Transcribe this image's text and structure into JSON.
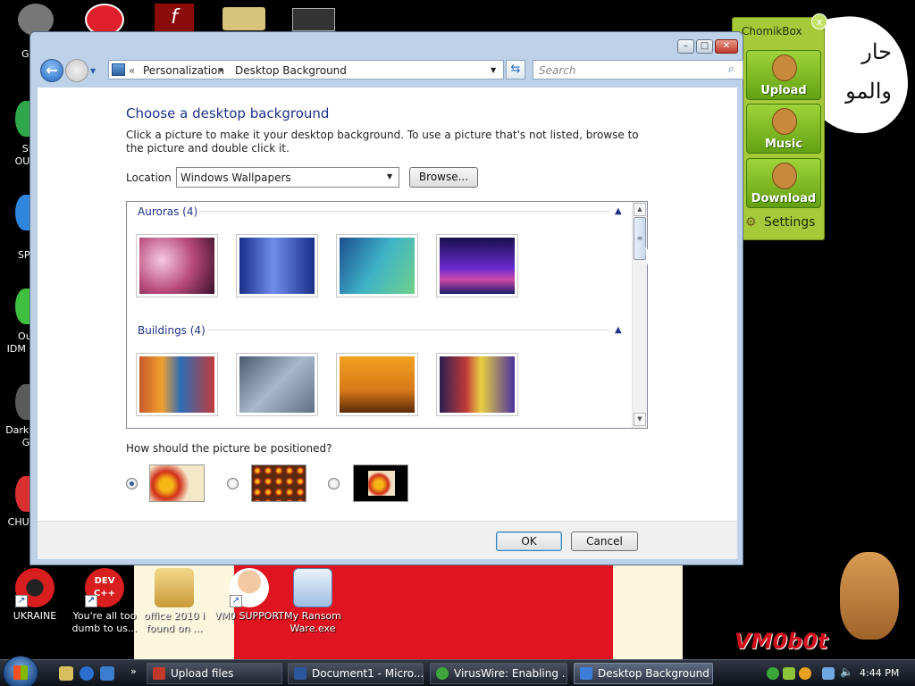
{
  "desktop": {
    "icons_left_partial": [
      "GA",
      "SH\nOUT",
      "C\nSPY",
      "Out\nIDM C",
      "DarkC\nGa",
      "CHUZ"
    ],
    "icons_bottom": [
      {
        "label": "UKRAINE"
      },
      {
        "label": "You're all too dumb to us..."
      },
      {
        "label": "office 2010 i found on ..."
      },
      {
        "label": "VM0 SUPPORT"
      },
      {
        "label": "My Ransom Ware.exe"
      }
    ],
    "arabic_text": "حار والمو",
    "watermark": "VM0b0t",
    "dev_badge": "DEV C++"
  },
  "chomikbox": {
    "title": "ChomikBox",
    "close": "x",
    "buttons": [
      {
        "label": "Upload"
      },
      {
        "label": "Music"
      },
      {
        "label": "Download"
      }
    ],
    "settings": "Settings"
  },
  "window": {
    "controls": {
      "minimize": "–",
      "maximize": "□",
      "close": "✕"
    },
    "breadcrumb": [
      "Personalization",
      "Desktop Background"
    ],
    "breadcrumb_sep": "▸",
    "search_placeholder": "Search",
    "heading": "Choose a desktop background",
    "instructions": "Click a picture to make it your desktop background. To use a picture that's not listed, browse to the picture and double click it.",
    "location_label": "Location",
    "location_value": "Windows Wallpapers",
    "browse_label": "Browse...",
    "groups": [
      {
        "title": "Auroras (4)",
        "thumb_colors": [
          "#b84a7a",
          "#2c4fb8",
          "#2a9cb3",
          "#4a2bb0"
        ]
      },
      {
        "title": "Buildings (4)",
        "thumb_colors": [
          "#c65a2a",
          "#7f93ad",
          "#d9791a",
          "#c03a3a"
        ]
      }
    ],
    "position_question": "How should the picture be positioned?",
    "position_options": [
      {
        "name": "fill",
        "selected": true
      },
      {
        "name": "tile",
        "selected": false
      },
      {
        "name": "center",
        "selected": false
      }
    ],
    "ok_label": "OK",
    "cancel_label": "Cancel"
  },
  "taskbar": {
    "buttons": [
      {
        "label": "Upload files",
        "icon_color": "#c0392b",
        "active": false
      },
      {
        "label": "Document1 - Micro...",
        "icon_color": "#2b579a",
        "active": false
      },
      {
        "label": "VirusWire: Enabling ...",
        "icon_color": "#3fa63f",
        "active": false
      },
      {
        "label": "Desktop Background",
        "icon_color": "#3b7dd8",
        "active": true
      }
    ],
    "clock": "4:44 PM"
  }
}
